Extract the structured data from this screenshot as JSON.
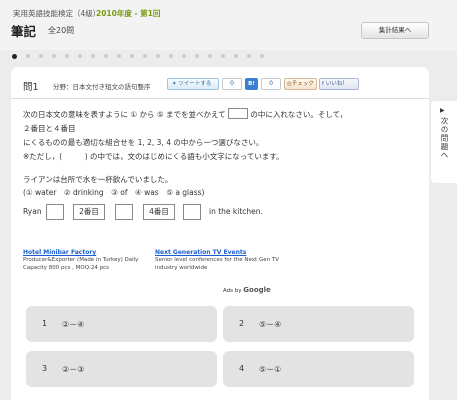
{
  "header": {
    "exam_name": "実用英語技能検定（4級）",
    "exam_year": "2010年度 - 第1回",
    "section_title": "筆記",
    "question_total": "全20問",
    "results_button": "集計結果へ"
  },
  "pagination": {
    "total_dots": 20,
    "current": 1
  },
  "question": {
    "number": "問1",
    "category": "分野：日本文付き短文の語句整序",
    "social": {
      "tweet_label": "ツイートする",
      "tweet_count": "0",
      "bookmark_label": "B!",
      "bookmark_count": "0",
      "check_label": "チェック",
      "like_label": "いいね！"
    },
    "instruction_part1": "次の日本文の意味を表すように ① から ⑤ までを並べかえて",
    "instruction_part2": "の中に入れなさい。そして，２番目と４番目",
    "instruction_line2": "にくるものの最も適切な組合せを 1, 2, 3, 4 の中から一つ選びなさい。",
    "note": "※ただし，(　　　) の中では，文のはじめにくる語も小文字になっています。",
    "japanese_sentence": "ライアンは台所で水を一杯飲んでいました。",
    "word_choices": "(① water　② drinking　③ of　④ was　⑤ a glass)",
    "sentence_start": "Ryan",
    "slot_second": "2番目",
    "slot_fourth": "4番目",
    "sentence_end": "in the kitchen."
  },
  "ads": {
    "ad1_title": "Hotel Minibar Factory",
    "ad1_text": "Producer&Exporter (Made in Turkey) Daily Capacity 800 pcs , MOQ:24 pcs",
    "ad2_title": "Next Generation TV Events",
    "ad2_text": "Senior level conferences for the Next Gen TV industry worldwide",
    "ads_by": "Ads by",
    "ads_by_brand": "Google"
  },
  "answers": [
    {
      "num": "1",
      "value": "②－④"
    },
    {
      "num": "2",
      "value": "⑤－④"
    },
    {
      "num": "3",
      "value": "②－③"
    },
    {
      "num": "4",
      "value": "⑤－①"
    }
  ],
  "next_question": {
    "arrow": "▶",
    "label": "次の問題へ"
  }
}
